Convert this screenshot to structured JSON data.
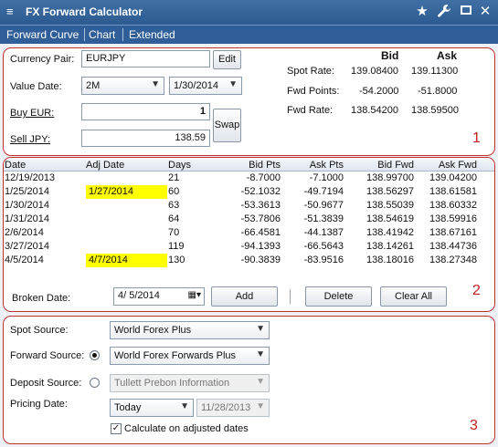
{
  "window": {
    "title": "FX Forward Calculator",
    "menu_icon": "hamburger-icon"
  },
  "menu": {
    "items": [
      "Forward Curve",
      "Chart",
      "Extended"
    ]
  },
  "panel1": {
    "currency_pair_label": "Currency Pair:",
    "currency_pair_value": "EURJPY",
    "edit_button": "Edit",
    "value_date_label": "Value Date:",
    "tenor_value": "2M",
    "value_date_value": "1/30/2014",
    "buy_label": "Buy EUR:",
    "buy_value": "1",
    "sell_label": "Sell JPY:",
    "sell_value": "138.59",
    "swap_button": "Swap",
    "bid_header": "Bid",
    "ask_header": "Ask",
    "spot_rate_label": "Spot Rate:",
    "spot_bid": "139.08400",
    "spot_ask": "139.11300",
    "fwd_points_label": "Fwd Points:",
    "fwd_points_bid": "-54.2000",
    "fwd_points_ask": "-51.8000",
    "fwd_rate_label": "Fwd Rate:",
    "fwd_rate_bid": "138.54200",
    "fwd_rate_ask": "138.59500",
    "marker": "1"
  },
  "table": {
    "columns": [
      "Date",
      "Adj Date",
      "Days",
      "Bid Pts",
      "Ask Pts",
      "Bid Fwd",
      "Ask Fwd"
    ],
    "rows": [
      {
        "date": "12/19/2013",
        "adj": "",
        "days": "21",
        "bid_pts": "-8.7000",
        "ask_pts": "-7.1000",
        "bid_fwd": "138.99700",
        "ask_fwd": "139.04200"
      },
      {
        "date": "1/25/2014",
        "adj": "1/27/2014",
        "days": "60",
        "bid_pts": "-52.1032",
        "ask_pts": "-49.7194",
        "bid_fwd": "138.56297",
        "ask_fwd": "138.61581"
      },
      {
        "date": "1/30/2014",
        "adj": "",
        "days": "63",
        "bid_pts": "-53.3613",
        "ask_pts": "-50.9677",
        "bid_fwd": "138.55039",
        "ask_fwd": "138.60332"
      },
      {
        "date": "1/31/2014",
        "adj": "",
        "days": "64",
        "bid_pts": "-53.7806",
        "ask_pts": "-51.3839",
        "bid_fwd": "138.54619",
        "ask_fwd": "138.59916"
      },
      {
        "date": "2/6/2014",
        "adj": "",
        "days": "70",
        "bid_pts": "-66.4581",
        "ask_pts": "-44.1387",
        "bid_fwd": "138.41942",
        "ask_fwd": "138.67161"
      },
      {
        "date": "3/27/2014",
        "adj": "",
        "days": "119",
        "bid_pts": "-94.1393",
        "ask_pts": "-66.5643",
        "bid_fwd": "138.14261",
        "ask_fwd": "138.44736"
      },
      {
        "date": "4/5/2014",
        "adj": "4/7/2014",
        "days": "130",
        "bid_pts": "-90.3839",
        "ask_pts": "-83.9516",
        "bid_fwd": "138.18016",
        "ask_fwd": "138.27348"
      }
    ],
    "highlight_color": "#ffff00"
  },
  "panel2": {
    "broken_date_label": "Broken Date:",
    "broken_date_value": "4/  5/2014",
    "add_button": "Add",
    "delete_button": "Delete",
    "clear_all_button": "Clear All",
    "marker": "2"
  },
  "panel3": {
    "spot_source_label": "Spot Source:",
    "spot_source_value": "World Forex Plus",
    "forward_source_label": "Forward Source:",
    "forward_source_value": "World Forex Forwards Plus",
    "deposit_source_label": "Deposit Source:",
    "deposit_source_value": "Tullett Prebon Information",
    "pricing_date_label": "Pricing Date:",
    "pricing_date_value": "Today",
    "pricing_date_disabled": "11/28/2013",
    "calc_adjusted_label": "Calculate on adjusted dates",
    "marker": "3"
  }
}
